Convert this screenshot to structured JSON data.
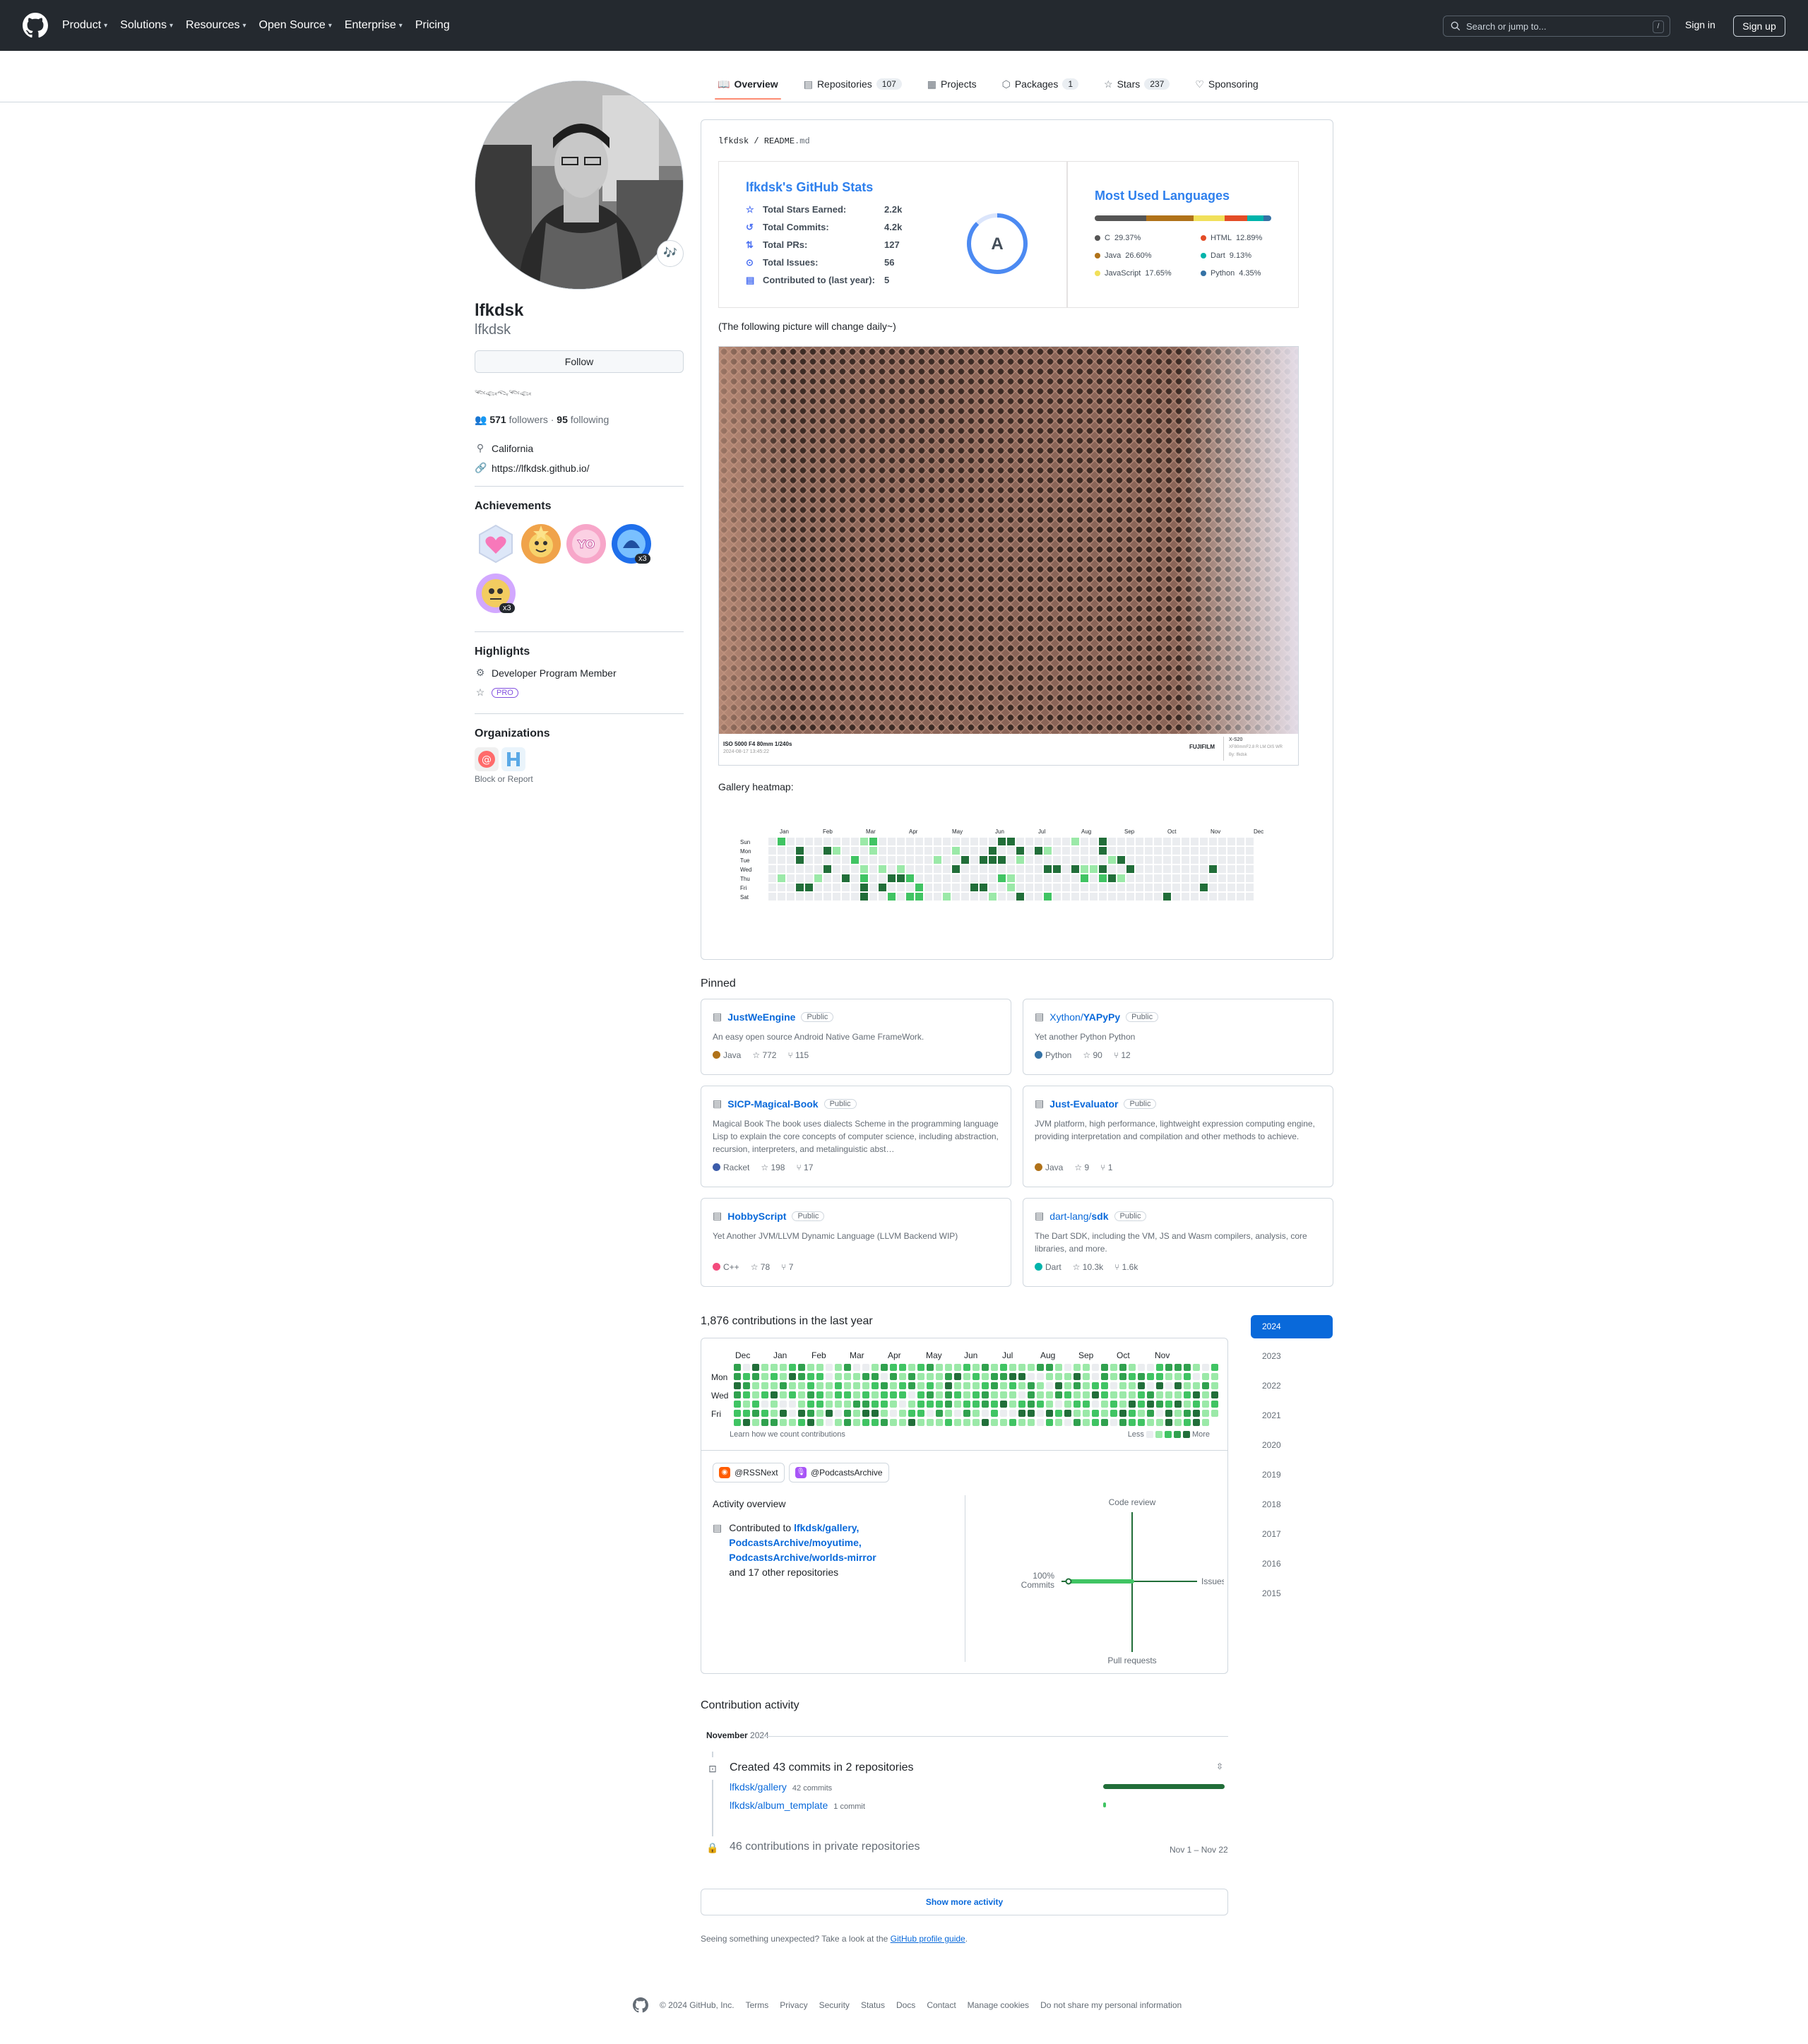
{
  "header": {
    "nav": [
      {
        "label": "Product",
        "caret": true
      },
      {
        "label": "Solutions",
        "caret": true
      },
      {
        "label": "Resources",
        "caret": true
      },
      {
        "label": "Open Source",
        "caret": true
      },
      {
        "label": "Enterprise",
        "caret": true
      },
      {
        "label": "Pricing",
        "caret": false
      }
    ],
    "search_placeholder": "Search or jump to...",
    "search_shortcut": "/",
    "signin": "Sign in",
    "signup": "Sign up"
  },
  "tabs": [
    {
      "label": "Overview",
      "icon": "book-icon",
      "count": "",
      "active": true
    },
    {
      "label": "Repositories",
      "icon": "repo-icon",
      "count": "107",
      "active": false
    },
    {
      "label": "Projects",
      "icon": "table-icon",
      "count": "",
      "active": false
    },
    {
      "label": "Packages",
      "icon": "package-icon",
      "count": "1",
      "active": false
    },
    {
      "label": "Stars",
      "icon": "star-icon",
      "count": "237",
      "active": false
    },
    {
      "label": "Sponsoring",
      "icon": "heart-icon",
      "count": "",
      "active": false
    }
  ],
  "profile": {
    "name": "lfkdsk",
    "login": "lfkdsk",
    "status_emoji": "🎶",
    "follow_label": "Follow",
    "bio": "𓆝𓆟𓆞𓆝𓆟",
    "followers_count": "571",
    "followers_label": "followers",
    "following_count": "95",
    "following_label": "following",
    "location": "California",
    "website": "https://lfkdsk.github.io/",
    "achievements_title": "Achievements",
    "achievements": [
      {
        "name": "heart-on-sleeve",
        "count": ""
      },
      {
        "name": "starstruck",
        "count": ""
      },
      {
        "name": "yolo",
        "count": ""
      },
      {
        "name": "pull-shark",
        "count": "x3"
      },
      {
        "name": "quickdraw",
        "count": "x3"
      }
    ],
    "highlights_title": "Highlights",
    "highlight_member": "Developer Program Member",
    "highlight_pro": "PRO",
    "organizations_title": "Organizations",
    "block_report": "Block or Report"
  },
  "readme": {
    "path_owner": "lfkdsk",
    "path_sep": "/",
    "path_file": "README",
    "path_ext": ".md",
    "stats": {
      "title": "lfkdsk's GitHub Stats",
      "rows": [
        {
          "icon": "star-icon",
          "label": "Total Stars Earned:",
          "value": "2.2k"
        },
        {
          "icon": "history-icon",
          "label": "Total Commits:",
          "value": "4.2k"
        },
        {
          "icon": "pull-request-icon",
          "label": "Total PRs:",
          "value": "127"
        },
        {
          "icon": "issue-icon",
          "label": "Total Issues:",
          "value": "56"
        },
        {
          "icon": "repo-icon",
          "label": "Contributed to (last year):",
          "value": "5"
        }
      ],
      "grade": "A"
    },
    "languages": {
      "title": "Most Used Languages",
      "items": [
        {
          "name": "C",
          "percent": "29.37%",
          "color": "#555555",
          "share": 29.37
        },
        {
          "name": "Java",
          "percent": "26.60%",
          "color": "#b07219",
          "share": 26.6
        },
        {
          "name": "JavaScript",
          "percent": "17.65%",
          "color": "#f1e05a",
          "share": 17.65
        },
        {
          "name": "HTML",
          "percent": "12.89%",
          "color": "#e34c26",
          "share": 12.89
        },
        {
          "name": "Dart",
          "percent": "9.13%",
          "color": "#00b4ab",
          "share": 9.13
        },
        {
          "name": "Python",
          "percent": "4.35%",
          "color": "#3572a5",
          "share": 4.35
        }
      ]
    },
    "daily_note": "(The following picture will change daily~)",
    "photo": {
      "exif": "ISO 5000 F4 80mm 1/240s",
      "date": "2024-08-17 13:45:22",
      "brand": "FUJIFILM",
      "model": "X-S20",
      "lens": "XF80mmF2.8 R LM OIS WR",
      "author": "By: lfkdsk"
    },
    "gallery_heatmap_label": "Gallery heatmap:",
    "gallery_months": [
      "Jan",
      "Feb",
      "Mar",
      "Apr",
      "May",
      "Jun",
      "Jul",
      "Aug",
      "Sep",
      "Oct",
      "Nov",
      "Dec"
    ],
    "gallery_days": [
      "Sun",
      "Mon",
      "Tue",
      "Wed",
      "Thu",
      "Fri",
      "Sat"
    ]
  },
  "pinned": {
    "title": "Pinned",
    "items": [
      {
        "owner": "",
        "name": "JustWeEngine",
        "visibility": "Public",
        "desc": "An easy open source Android Native Game FrameWork.",
        "lang": "Java",
        "lang_color": "#b07219",
        "stars": "772",
        "forks": "115"
      },
      {
        "owner": "Xython/",
        "name": "YAPyPy",
        "visibility": "Public",
        "desc": "Yet another Python Python",
        "lang": "Python",
        "lang_color": "#3572a5",
        "stars": "90",
        "forks": "12"
      },
      {
        "owner": "",
        "name": "SICP-Magical-Book",
        "visibility": "Public",
        "desc": "Magical Book The book uses dialects Scheme in the programming language Lisp to explain the core concepts of computer science, including abstraction, recursion, interpreters, and metalinguistic abst…",
        "lang": "Racket",
        "lang_color": "#3c5caa",
        "stars": "198",
        "forks": "17"
      },
      {
        "owner": "",
        "name": "Just-Evaluator",
        "visibility": "Public",
        "desc": "JVM platform, high performance, lightweight expression computing engine, providing interpretation and compilation and other methods to achieve.",
        "lang": "Java",
        "lang_color": "#b07219",
        "stars": "9",
        "forks": "1"
      },
      {
        "owner": "",
        "name": "HobbyScript",
        "visibility": "Public",
        "desc": "Yet Another JVM/LLVM Dynamic Language (LLVM Backend WIP)",
        "lang": "C++",
        "lang_color": "#f34b7d",
        "stars": "78",
        "forks": "7"
      },
      {
        "owner": "dart-lang/",
        "name": "sdk",
        "visibility": "Public",
        "desc": "The Dart SDK, including the VM, JS and Wasm compilers, analysis, core libraries, and more.",
        "lang": "Dart",
        "lang_color": "#00b4ab",
        "stars": "10.3k",
        "forks": "1.6k"
      }
    ]
  },
  "contributions": {
    "title": "1,876 contributions in the last year",
    "months": [
      "Dec",
      "Jan",
      "Feb",
      "Mar",
      "Apr",
      "May",
      "Jun",
      "Jul",
      "Aug",
      "Sep",
      "Oct",
      "Nov"
    ],
    "days": [
      "Mon",
      "Wed",
      "Fri"
    ],
    "learn": "Learn how we count contributions",
    "less": "Less",
    "more": "More",
    "orgs": [
      {
        "name": "@RSSNext",
        "color": "#ff5c00"
      },
      {
        "name": "@PodcastsArchive",
        "color": "#a855f7"
      }
    ],
    "activity_overview": "Activity overview",
    "contributed_to_label": "Contributed to",
    "repos": [
      "lfkdsk/gallery,",
      "PodcastsArchive/moyutime,",
      "PodcastsArchive/worlds-mirror"
    ],
    "other_repos": "and 17 other repositories",
    "radar": {
      "code_review": "Code review",
      "issues": "Issues",
      "pull_requests": "Pull requests",
      "commits": "Commits",
      "commits_percent": "100%",
      "commits_share": 1.0
    },
    "years": [
      "2024",
      "2023",
      "2022",
      "2021",
      "2020",
      "2019",
      "2018",
      "2017",
      "2016",
      "2015"
    ],
    "selected_year": "2024"
  },
  "activity": {
    "title": "Contribution activity",
    "month": "November",
    "year": "2024",
    "created": "Created 43 commits in 2 repositories",
    "repos": [
      {
        "name": "lfkdsk/gallery",
        "commits": "42 commits",
        "share": 0.98
      },
      {
        "name": "lfkdsk/album_template",
        "commits": "1 commit",
        "share": 0.02
      }
    ],
    "private": "46 contributions in private repositories",
    "daterange": "Nov 1 – Nov 22",
    "show_more": "Show more activity",
    "unexpected": "Seeing something unexpected? Take a look at the",
    "guide_link": "GitHub profile guide",
    "guide_suffix": "."
  },
  "footer": {
    "copyright": "© 2024 GitHub, Inc.",
    "links": [
      "Terms",
      "Privacy",
      "Security",
      "Status",
      "Docs",
      "Contact",
      "Manage cookies",
      "Do not share my personal information"
    ]
  }
}
